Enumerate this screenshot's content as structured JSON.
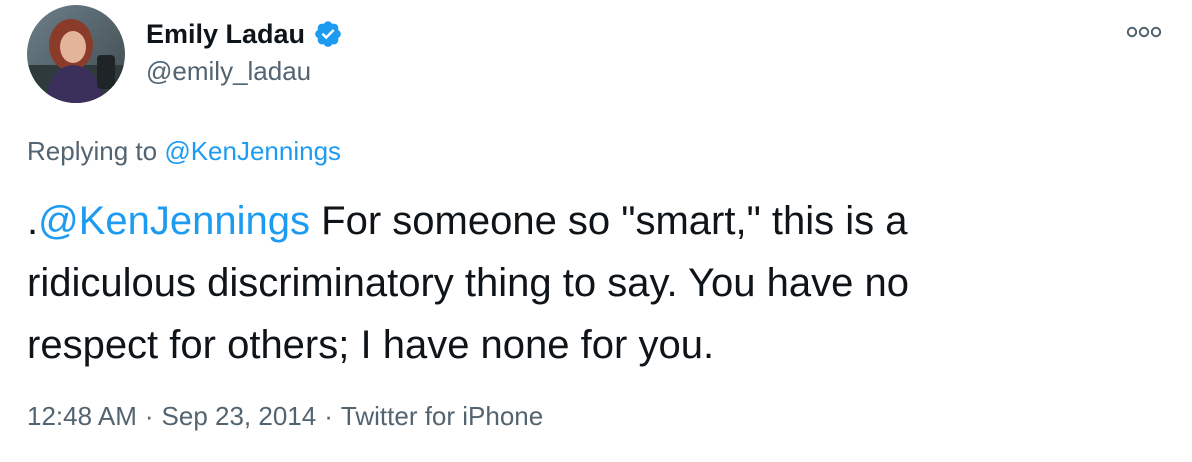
{
  "tweet": {
    "author": {
      "display_name": "Emily Ladau",
      "handle": "@emily_ladau",
      "verified": true,
      "avatar_icon": "profile-photo"
    },
    "more_icon": "more-dots-icon",
    "reply": {
      "prefix": "Replying to ",
      "mention": "@KenJennings"
    },
    "body": {
      "lead": ".",
      "mention": "@KenJennings",
      "text": " For someone so \"smart,\" this is a ridiculous discriminatory thing to say. You have no respect for others; I have none for you."
    },
    "meta": {
      "time": "12:48 AM",
      "separator": "·",
      "date": "Sep 23, 2014",
      "source": "Twitter for iPhone"
    },
    "colors": {
      "accent": "#1d9bf0",
      "secondary_text": "#536471",
      "primary_text": "#0f1419"
    }
  }
}
